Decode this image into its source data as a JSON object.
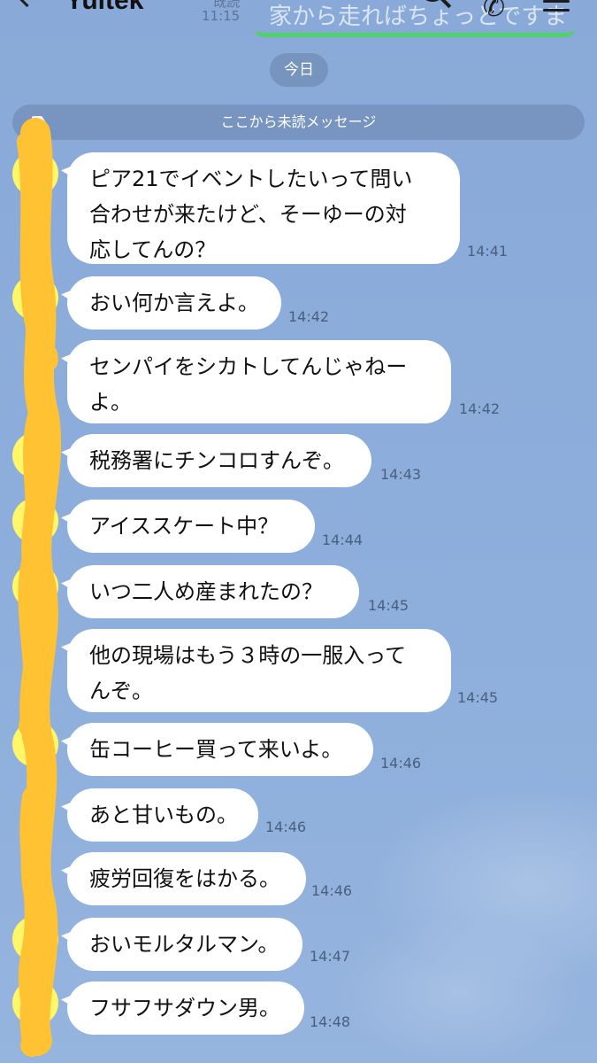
{
  "header": {
    "title": "Yuitek",
    "read_status": "既読",
    "read_time": "11:15",
    "pinned_preview_text": "家から走ればちょっとですま"
  },
  "date_label": "今日",
  "unread_divider": "ここから未読メッセージ",
  "messages": [
    {
      "lines": [
        "ピア21でイベントしたいって問い",
        "合わせが来たけど、そーゆーの対",
        "応してんの？"
      ],
      "time": "14:41"
    },
    {
      "lines": [
        "おい何か言えよ。"
      ],
      "time": "14:42"
    },
    {
      "lines": [
        "センパイをシカトしてんじゃねー",
        "よ。"
      ],
      "time": "14:42"
    },
    {
      "lines": [
        "税務署にチンコロすんぞ。"
      ],
      "time": "14:43"
    },
    {
      "lines": [
        "アイススケート中？"
      ],
      "time": "14:44"
    },
    {
      "lines": [
        "いつ二人め産まれたの？"
      ],
      "time": "14:45"
    },
    {
      "lines": [
        "他の現場はもう３時の一服入って",
        "んぞ。"
      ],
      "time": "14:45"
    },
    {
      "lines": [
        "缶コーヒー買って来いよ。"
      ],
      "time": "14:46"
    },
    {
      "lines": [
        "あと甘いもの。"
      ],
      "time": "14:46"
    },
    {
      "lines": [
        "疲労回復をはかる。"
      ],
      "time": "14:46"
    },
    {
      "lines": [
        "おいモルタルマン。"
      ],
      "time": "14:47"
    },
    {
      "lines": [
        "フサフサダウン男。"
      ],
      "time": "14:48"
    }
  ],
  "colors": {
    "background": "#8faedb",
    "bubble": "#ffffff",
    "avatar": "#fff66a",
    "scribble": "#ffc233",
    "pinned_underline": "#4fd26a"
  }
}
